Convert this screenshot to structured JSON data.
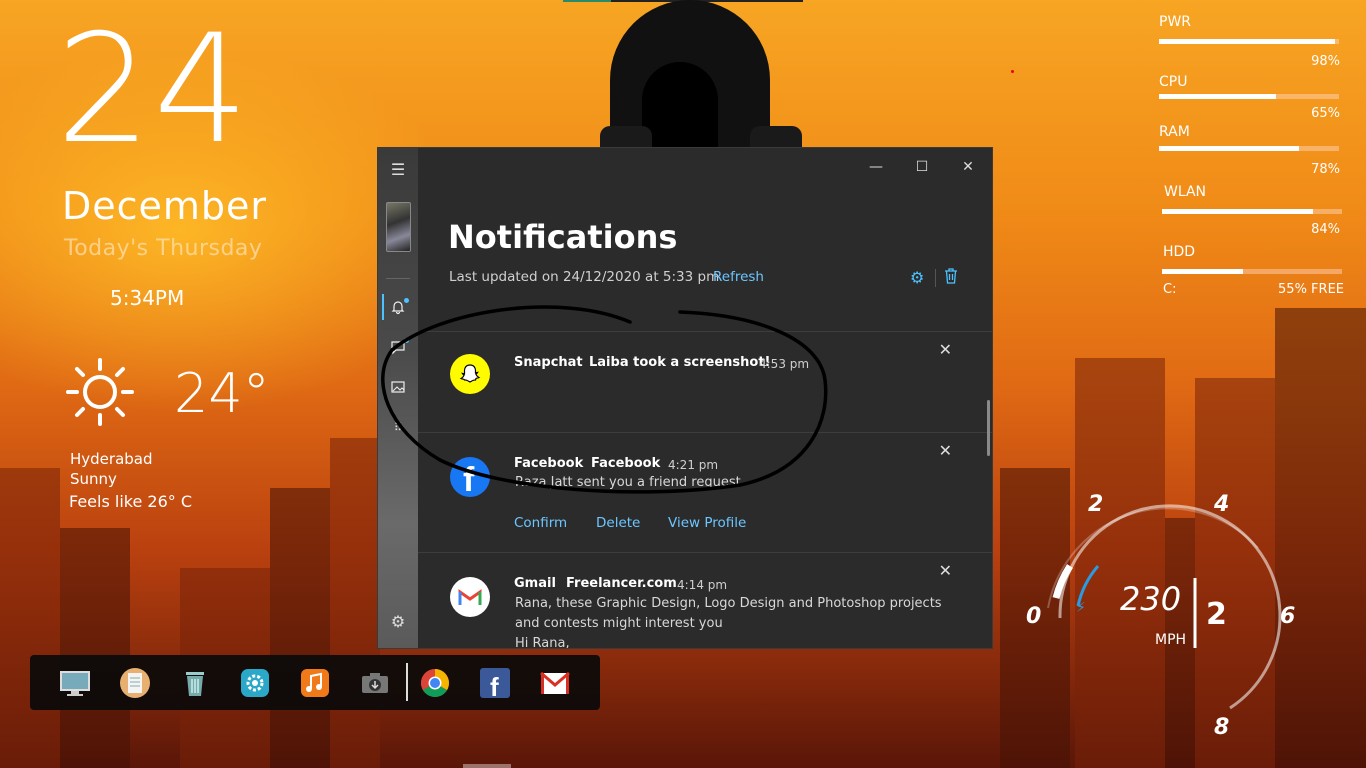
{
  "clock": {
    "day": "24",
    "month": "December",
    "weekday_text": "Today's Thursday",
    "time": "5:34PM",
    "temperature": "24°",
    "city": "Hyderabad",
    "condition": "Sunny",
    "feels_like": "Feels like 26° C"
  },
  "system": [
    {
      "label": "PWR",
      "value": "98%",
      "fill": 0.98
    },
    {
      "label": "CPU",
      "value": "65%",
      "fill": 0.65
    },
    {
      "label": "RAM",
      "value": "78%",
      "fill": 0.78
    },
    {
      "label": "WLAN",
      "value": "84%",
      "fill": 0.84
    },
    {
      "label": "HDD",
      "drive": "C:",
      "value": "55% FREE",
      "fill": 0.45
    }
  ],
  "gauge": {
    "speed": "230",
    "unit": "MPH",
    "gear": "2",
    "ticks": [
      "0",
      "2",
      "4",
      "6",
      "8"
    ]
  },
  "window": {
    "heading": "Notifications",
    "last_updated": "Last updated on 24/12/2020 at 5:33 pm",
    "refresh": "Refresh",
    "minimize": "—",
    "maximize": "☐",
    "close": "✕",
    "rail_icons": [
      "hamburger-icon",
      "bell-icon",
      "chat-icon",
      "image-icon",
      "dialpad-icon",
      "gear-icon"
    ]
  },
  "notifications": [
    {
      "app": "Snapchat",
      "title": "Laiba took a screenshot!",
      "time": "4:53 pm",
      "body": "",
      "actions": [],
      "icon_color": "#fffc00"
    },
    {
      "app": "Facebook",
      "title": "Facebook",
      "time": "4:21 pm",
      "body": "Raza Jatt sent you a friend request.",
      "actions": [
        "Confirm",
        "Delete",
        "View Profile"
      ],
      "icon_color": "#1877f2"
    },
    {
      "app": "Gmail",
      "title": "Freelancer.com",
      "time": "4:14 pm",
      "body": "Rana, these Graphic Design, Logo Design and Photoshop projects and contests might interest you",
      "body2": "Hi Rana,",
      "actions": [],
      "icon_color": "#ffffff"
    }
  ],
  "dock": [
    "monitor-icon",
    "notepad-icon",
    "trash-icon",
    "settings-gear-icon",
    "music-icon",
    "camera-icon",
    "chrome-icon",
    "facebook-icon",
    "gmail-icon"
  ],
  "colors": {
    "accent": "#4cc2ff",
    "link": "#6cc6ff",
    "window_bg": "#2b2b2b"
  }
}
